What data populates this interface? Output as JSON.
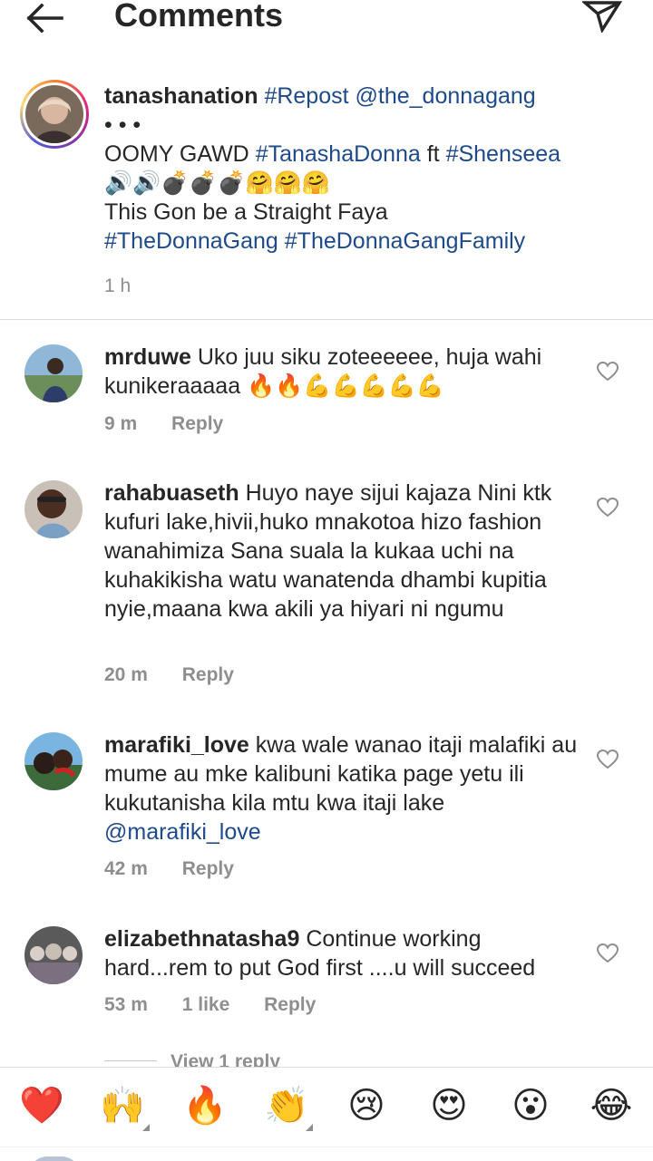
{
  "header": {
    "title": "Comments",
    "back_icon": "arrow-left-icon",
    "send_icon": "paper-plane-icon"
  },
  "caption": {
    "username": "tanashanation",
    "repost_tag": "#Repost",
    "repost_user": "@the_donnagang",
    "dots": "• • •",
    "line1_prefix": "OOMY GAWD ",
    "tag1": "#TanashaDonna",
    "ft": " ft ",
    "tag2": "#Shenseea",
    "emojis": "🔊🔊💣💣💣🤗🤗🤗",
    "line3": "This Gon be a Straight Faya",
    "tag3": "#TheDonnaGang",
    "tag4": "#TheDonnaGangFamily",
    "time": "1 h"
  },
  "comments": [
    {
      "username": "mrduwe",
      "text": "Uko juu siku zoteeeeee, huja wahi kunikeraaaaa 🔥🔥💪💪💪💪💪",
      "time": "9 m",
      "likes": "",
      "reply": "Reply"
    },
    {
      "username": "rahabuaseth",
      "text": "Huyo naye sijui kajaza Nini ktk kufuri lake,hivii,huko mnakotoa hizo fashion wanahimiza Sana suala la kukaa uchi na kuhakikisha watu wanatenda dhambi kupitia nyie,maana kwa akili ya hiyari ni ngumu",
      "time": "20 m",
      "likes": "",
      "reply": "Reply"
    },
    {
      "username": "marafiki_love",
      "text": "kwa wale wanao itaji malafiki au mume au mke kalibuni katika page yetu ili kukutanisha kila mtu kwa itaji lake",
      "mention": "@marafiki_love",
      "time": "42 m",
      "likes": "",
      "reply": "Reply"
    },
    {
      "username": "elizabethnatasha9",
      "text": "Continue working hard...rem to put God first ....u will succeed",
      "time": "53 m",
      "likes": "1 like",
      "reply": "Reply"
    }
  ],
  "view_replies": "View 1 reply",
  "emoji_bar": [
    "❤️",
    "🙌",
    "🔥",
    "👏",
    "😢",
    "😍",
    "😮",
    "😂"
  ],
  "colors": {
    "hashtag": "#1e4a8a",
    "muted": "#8e8e8e",
    "text": "#262626",
    "heart_red": "#ed1c24"
  }
}
